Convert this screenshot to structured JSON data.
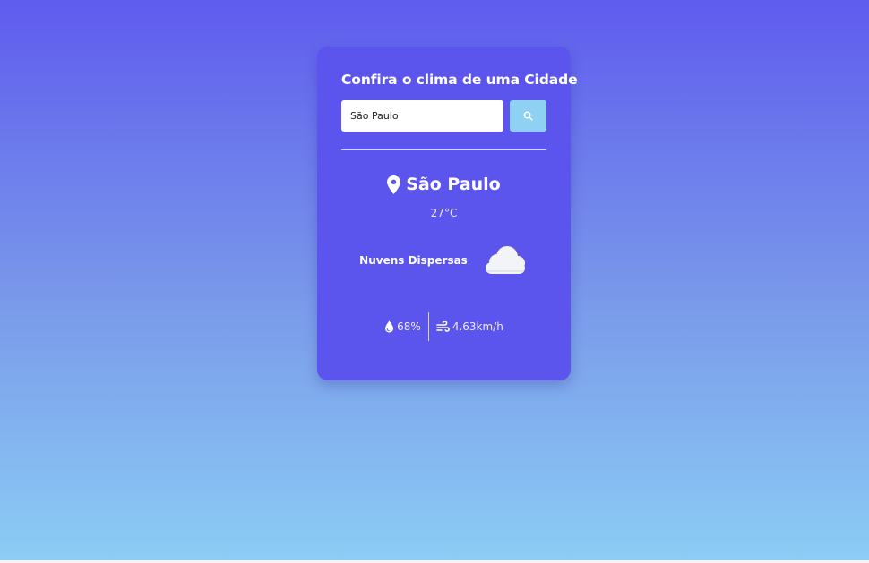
{
  "card": {
    "title": "Confira o clima de uma Cidade"
  },
  "search": {
    "value": "São Paulo",
    "button_icon": "search-icon"
  },
  "weather": {
    "location_icon": "map-pin-icon",
    "city": "São Paulo",
    "temperature": "27°C",
    "description": "Nuvens Dispersas",
    "condition_icon": "cloud-icon",
    "humidity_icon": "droplet-icon",
    "humidity": "68%",
    "wind_icon": "wind-icon",
    "wind": "4.63km/h"
  },
  "colors": {
    "card_background": "#5b55ee",
    "search_button": "#8fd1f2",
    "gradient_top": "#5f5cee",
    "gradient_bottom": "#8ccdf5"
  }
}
